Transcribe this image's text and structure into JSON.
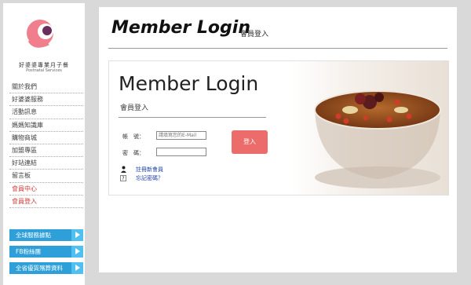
{
  "brand": {
    "name_cn": "好婆婆專業月子餐",
    "name_en": "Postnatal Services"
  },
  "nav": {
    "items": [
      {
        "label": "關於我們"
      },
      {
        "label": "好婆婆服務"
      },
      {
        "label": "活動訊息"
      },
      {
        "label": "媽媽知識庫"
      },
      {
        "label": "購物商城"
      },
      {
        "label": "加盟專區"
      },
      {
        "label": "好站連結"
      },
      {
        "label": "留言板"
      },
      {
        "label": "會員中心",
        "active": true
      },
      {
        "label": "會員登入",
        "active": true
      }
    ]
  },
  "side_buttons": [
    {
      "label": "全球服務據點"
    },
    {
      "label": "FB粉絲團"
    },
    {
      "label": "全省優質殯葬資料"
    }
  ],
  "header": {
    "title": "Member Login",
    "subtitle": "會員登入"
  },
  "panel": {
    "title": "Member Login",
    "subtitle": "會員登入"
  },
  "form": {
    "account_label": "帳　號：",
    "account_placeholder": "請填寫您的E-Mail",
    "password_label": "密　碼：",
    "login_button": "登入"
  },
  "links": {
    "register": "註冊新會員",
    "forgot": "忘記密碼？"
  },
  "icons": {
    "register": "member-icon",
    "forgot": "question-icon"
  },
  "colors": {
    "accent": "#ec6b6b",
    "nav_active": "#c83a3a",
    "side_button": "#2e9fd8",
    "link": "#1d3fa8"
  }
}
